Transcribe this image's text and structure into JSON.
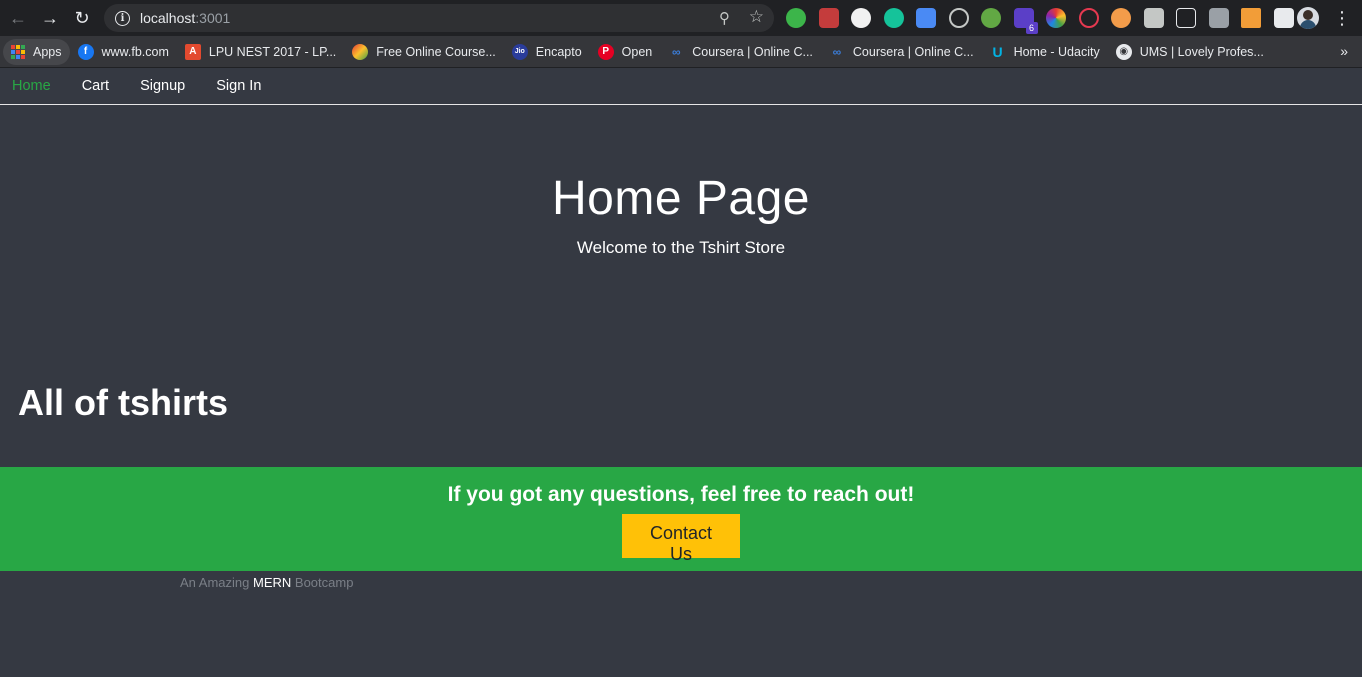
{
  "browser": {
    "url_host": "localhost",
    "url_port": ":3001",
    "bookmarks": [
      {
        "label": "Apps",
        "icon": "apps-grid-icon"
      },
      {
        "label": "www.fb.com",
        "icon": "facebook-icon",
        "color": "#1877f2"
      },
      {
        "label": "LPU NEST 2017 - LP...",
        "icon": "lpu-icon",
        "color": "#e34a2f"
      },
      {
        "label": "Free Online Course...",
        "icon": "course-icon",
        "color": "#6a9b2c"
      },
      {
        "label": "Encapto",
        "icon": "jio-icon",
        "color": "#2a3c9b"
      },
      {
        "label": "Open",
        "icon": "pinterest-icon",
        "color": "#e60023"
      },
      {
        "label": "Coursera | Online C...",
        "icon": "coursera-icon",
        "color": "#3b7dd8"
      },
      {
        "label": "Coursera | Online C...",
        "icon": "coursera-icon",
        "color": "#3b7dd8"
      },
      {
        "label": "Home - Udacity",
        "icon": "udacity-icon",
        "color": "#02b3e4"
      },
      {
        "label": "UMS | Lovely Profes...",
        "icon": "globe-icon",
        "color": "#e8eaed"
      }
    ],
    "extension_badge": "6"
  },
  "nav": {
    "items": [
      {
        "label": "Home",
        "active": true
      },
      {
        "label": "Cart",
        "active": false
      },
      {
        "label": "Signup",
        "active": false
      },
      {
        "label": "Sign In",
        "active": false
      }
    ]
  },
  "hero": {
    "title": "Home Page",
    "subtitle": "Welcome to the Tshirt Store"
  },
  "products": {
    "heading": "All of tshirts"
  },
  "footer": {
    "question": "If you got any questions, feel free to reach out!",
    "contact_label": "Contact Us",
    "tagline_prefix": "An Amazing ",
    "tagline_strong": "MERN",
    "tagline_suffix": " Bootcamp"
  },
  "colors": {
    "page_bg": "#353942",
    "accent_green": "#28a745",
    "button_yellow": "#ffc107"
  }
}
